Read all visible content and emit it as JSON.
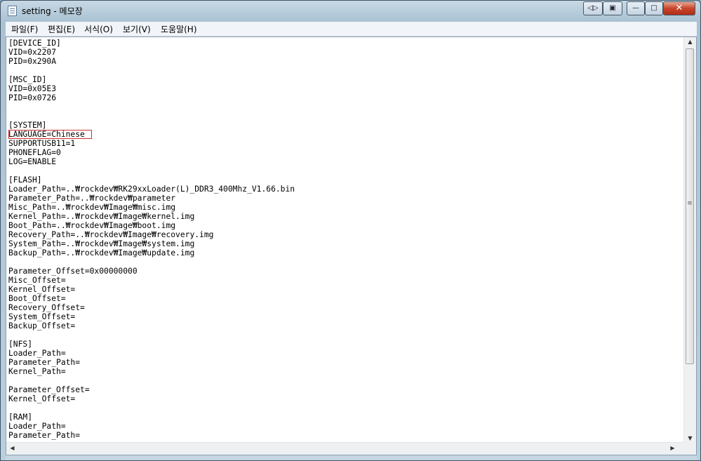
{
  "window": {
    "title": "setting - 메모장"
  },
  "titlebar_buttons": {
    "extra1": "◁▷",
    "extra2": "▣",
    "minimize": "—",
    "maximize": "□",
    "close": "✕"
  },
  "menu": {
    "items": [
      "파일(F)",
      "편집(E)",
      "서식(O)",
      "보기(V)",
      "도움말(H)"
    ]
  },
  "editor": {
    "lines": [
      "[DEVICE_ID]",
      "VID=0x2207",
      "PID=0x290A",
      "",
      "[MSC_ID]",
      "VID=0x05E3",
      "PID=0x0726",
      "",
      "",
      "[SYSTEM]",
      "LANGUAGE=Chinese",
      "SUPPORTUSB11=1",
      "PHONEFLAG=0",
      "LOG=ENABLE",
      "",
      "[FLASH]",
      "Loader_Path=..₩rockdev₩RK29xxLoader(L)_DDR3_400Mhz_V1.66.bin",
      "Parameter_Path=..₩rockdev₩parameter",
      "Misc_Path=..₩rockdev₩Image₩misc.img",
      "Kernel_Path=..₩rockdev₩Image₩kernel.img",
      "Boot_Path=..₩rockdev₩Image₩boot.img",
      "Recovery_Path=..₩rockdev₩Image₩recovery.img",
      "System_Path=..₩rockdev₩Image₩system.img",
      "Backup_Path=..₩rockdev₩Image₩update.img",
      "",
      "Parameter_Offset=0x00000000",
      "Misc_Offset=",
      "Kernel_Offset=",
      "Boot_Offset=",
      "Recovery_Offset=",
      "System_Offset=",
      "Backup_Offset=",
      "",
      "[NFS]",
      "Loader_Path=",
      "Parameter_Path=",
      "Kernel_Path=",
      "",
      "Parameter_Offset=",
      "Kernel_Offset=",
      "",
      "[RAM]",
      "Loader_Path=",
      "Parameter_Path="
    ]
  },
  "scroll": {
    "up": "▲",
    "down": "▼",
    "left": "◀",
    "right": "▶",
    "grip": "≡"
  }
}
